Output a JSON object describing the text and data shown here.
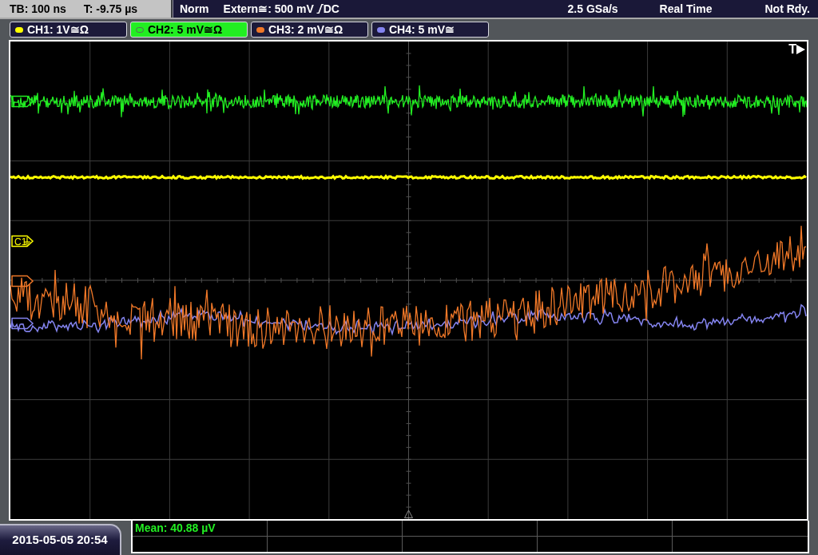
{
  "status_bar": {
    "timebase": "TB: 100 ns",
    "trigger_time": "T: -9.75 µs",
    "trigger_mode": "Norm",
    "trigger_source": "Extern≅: 500 mV",
    "trigger_coupling": "DC",
    "sample_rate": "2.5 GSa/s",
    "acquisition_mode": "Real Time",
    "status": "Not Rdy."
  },
  "channels": [
    {
      "label": "CH1: 1V≅Ω",
      "color": "#ffff00",
      "selected": false,
      "marker_label": "C1"
    },
    {
      "label": "CH2: 5 mV≅Ω",
      "color": "#22ee22",
      "selected": true
    },
    {
      "label": "CH3: 2 mV≅Ω",
      "color": "#f07828",
      "selected": false
    },
    {
      "label": "CH4: 5 mV≅",
      "color": "#8484f0",
      "selected": false
    }
  ],
  "display": {
    "trigger_label": "T"
  },
  "date_time": "2015-05-05 20:54",
  "measurements": [
    "Mean: 40.88 µV"
  ]
}
